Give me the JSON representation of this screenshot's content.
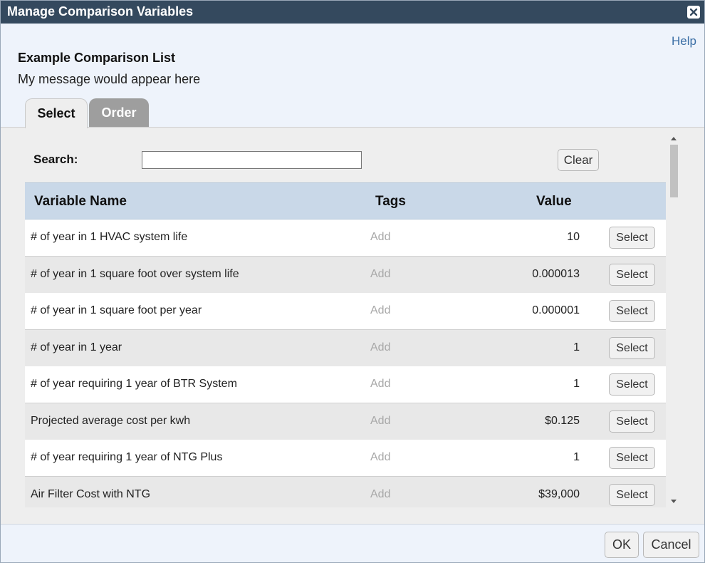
{
  "window": {
    "title": "Manage Comparison Variables"
  },
  "header": {
    "help_label": "Help",
    "list_title": "Example Comparison List",
    "message": "My message would appear here"
  },
  "tabs": [
    {
      "label": "Select",
      "active": true
    },
    {
      "label": "Order",
      "active": false
    }
  ],
  "search": {
    "label": "Search:",
    "value": "",
    "placeholder": "",
    "clear_label": "Clear"
  },
  "table": {
    "columns": {
      "name": "Variable Name",
      "tags": "Tags",
      "value": "Value"
    },
    "rows": [
      {
        "name": "# of year in 1 HVAC system life",
        "tags": "Add",
        "value": "10",
        "action": "Select"
      },
      {
        "name": "# of year in 1 square foot over system life",
        "tags": "Add",
        "value": "0.000013",
        "action": "Select"
      },
      {
        "name": "# of year in 1 square foot per year",
        "tags": "Add",
        "value": "0.000001",
        "action": "Select"
      },
      {
        "name": "# of year in 1 year",
        "tags": "Add",
        "value": "1",
        "action": "Select"
      },
      {
        "name": "# of year requiring 1 year of BTR System",
        "tags": "Add",
        "value": "1",
        "action": "Select"
      },
      {
        "name": "Projected average cost per kwh",
        "tags": "Add",
        "value": "$0.125",
        "action": "Select"
      },
      {
        "name": "# of year requiring 1 year of NTG Plus",
        "tags": "Add",
        "value": "1",
        "action": "Select"
      },
      {
        "name": "Air Filter Cost with NTG",
        "tags": "Add",
        "value": "$39,000",
        "action": "Select"
      }
    ]
  },
  "footer": {
    "ok_label": "OK",
    "cancel_label": "Cancel"
  },
  "colors": {
    "titlebar": "#34495e",
    "header_row": "#c9d8e8",
    "link": "#3a6ea5",
    "dialog_bg": "#eef3fb"
  },
  "icons": {
    "close": "close-icon",
    "scroll_up": "arrow-up-icon",
    "scroll_down": "arrow-down-icon"
  }
}
